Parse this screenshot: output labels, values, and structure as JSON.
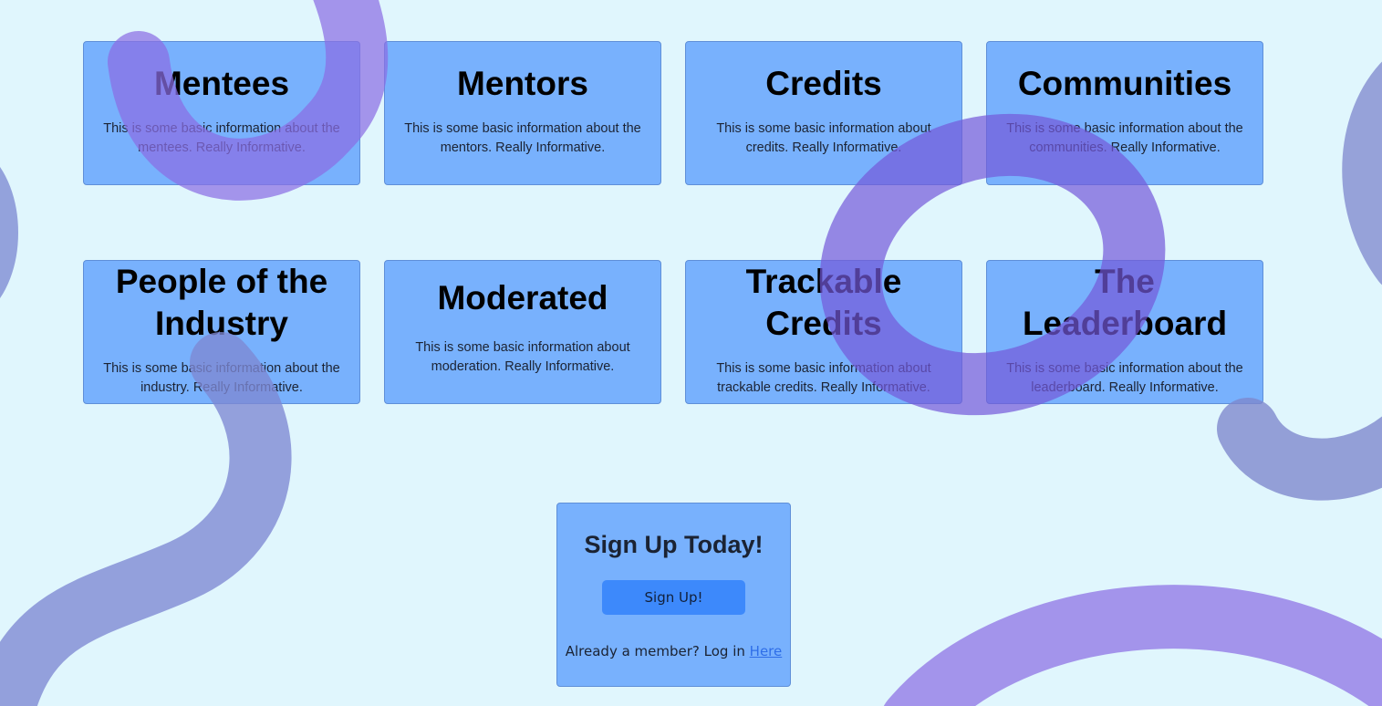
{
  "cards": [
    {
      "title": "Mentees",
      "text": "This is some basic information about the mentees. Really Informative."
    },
    {
      "title": "Mentors",
      "text": "This is some basic information about the mentors. Really Informative."
    },
    {
      "title": "Credits",
      "text": "This is some basic information about credits. Really Informative."
    },
    {
      "title": "Communities",
      "text": "This is some basic information about the communities. Really Informative."
    },
    {
      "title": "People of the Industry",
      "text": "This is some basic information about the industry. Really Informative."
    },
    {
      "title": "Moderated",
      "text": "This is some basic information about moderation. Really Informative."
    },
    {
      "title": "Trackable Credits",
      "text": "This is some basic information about trackable credits. Really Informative."
    },
    {
      "title": "The Leaderboard",
      "text": "This is some basic information about the leaderboard. Really Informative."
    }
  ],
  "signup": {
    "title": "Sign Up Today!",
    "button_label": "Sign Up!",
    "login_prompt": "Already a member? Log in",
    "login_link": "Here"
  },
  "colors": {
    "background": "#e0f6fd",
    "card": "#78b1fd",
    "button": "#3d89fb",
    "swirl_purple": "#8b6fe0",
    "swirl_slate": "#7f86cc",
    "link": "#2f6ee8"
  }
}
